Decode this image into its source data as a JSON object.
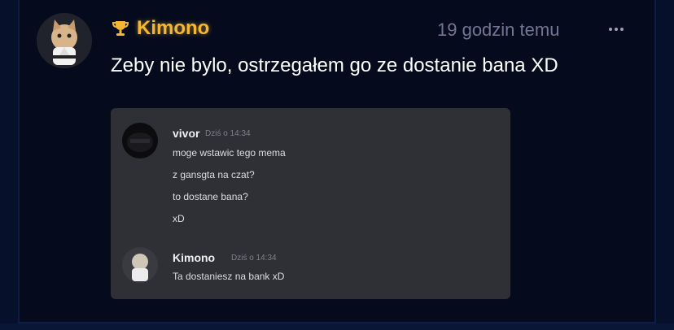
{
  "post": {
    "author": "Kimono",
    "timestamp": "19 godzin temu",
    "text": "Zeby nie bylo, ostrzegałem go ze dostanie bana XD",
    "author_color": "#f4b733",
    "badge_icon": "trophy-icon",
    "menu_icon": "more-dots-icon"
  },
  "screenshot": {
    "messages": [
      {
        "author": "vivor",
        "time": "Dziś o 14:34",
        "lines": [
          "moge wstawic tego mema",
          "z gansgta na czat?",
          "to dostane bana?",
          "xD"
        ]
      },
      {
        "author": "Kimono",
        "time": "Dziś o 14:34",
        "lines": [
          "Ta dostaniesz na bank xD"
        ]
      }
    ]
  }
}
